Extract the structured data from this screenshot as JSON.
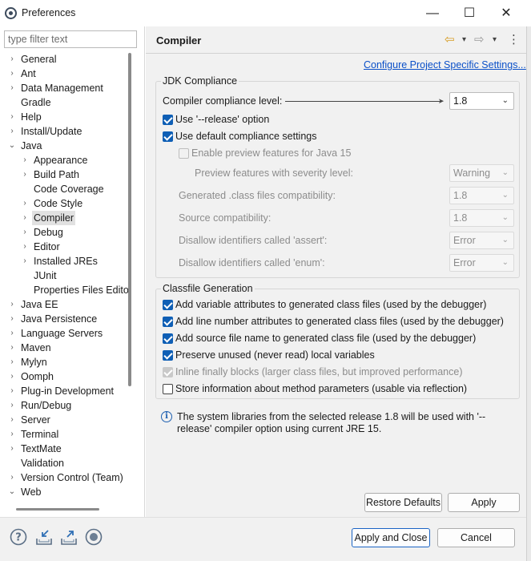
{
  "window": {
    "title": "Preferences",
    "controls": {
      "minimize": "—",
      "maximize": "☐",
      "close": "✕"
    }
  },
  "filter": {
    "placeholder": "type filter text",
    "value": ""
  },
  "tree": [
    {
      "label": "General",
      "arrow": "›",
      "depth": 0
    },
    {
      "label": "Ant",
      "arrow": "›",
      "depth": 0
    },
    {
      "label": "Data Management",
      "arrow": "›",
      "depth": 0
    },
    {
      "label": "Gradle",
      "arrow": "",
      "depth": 0
    },
    {
      "label": "Help",
      "arrow": "›",
      "depth": 0
    },
    {
      "label": "Install/Update",
      "arrow": "›",
      "depth": 0
    },
    {
      "label": "Java",
      "arrow": "⌄",
      "depth": 0
    },
    {
      "label": "Appearance",
      "arrow": "›",
      "depth": 1
    },
    {
      "label": "Build Path",
      "arrow": "›",
      "depth": 1
    },
    {
      "label": "Code Coverage",
      "arrow": "",
      "depth": 1
    },
    {
      "label": "Code Style",
      "arrow": "›",
      "depth": 1
    },
    {
      "label": "Compiler",
      "arrow": "›",
      "depth": 1,
      "selected": true
    },
    {
      "label": "Debug",
      "arrow": "›",
      "depth": 1
    },
    {
      "label": "Editor",
      "arrow": "›",
      "depth": 1
    },
    {
      "label": "Installed JREs",
      "arrow": "›",
      "depth": 1
    },
    {
      "label": "JUnit",
      "arrow": "",
      "depth": 1
    },
    {
      "label": "Properties Files Edito",
      "arrow": "",
      "depth": 1
    },
    {
      "label": "Java EE",
      "arrow": "›",
      "depth": 0
    },
    {
      "label": "Java Persistence",
      "arrow": "›",
      "depth": 0
    },
    {
      "label": "Language Servers",
      "arrow": "›",
      "depth": 0
    },
    {
      "label": "Maven",
      "arrow": "›",
      "depth": 0
    },
    {
      "label": "Mylyn",
      "arrow": "›",
      "depth": 0
    },
    {
      "label": "Oomph",
      "arrow": "›",
      "depth": 0
    },
    {
      "label": "Plug-in Development",
      "arrow": "›",
      "depth": 0
    },
    {
      "label": "Run/Debug",
      "arrow": "›",
      "depth": 0
    },
    {
      "label": "Server",
      "arrow": "›",
      "depth": 0
    },
    {
      "label": "Terminal",
      "arrow": "›",
      "depth": 0
    },
    {
      "label": "TextMate",
      "arrow": "›",
      "depth": 0
    },
    {
      "label": "Validation",
      "arrow": "",
      "depth": 0
    },
    {
      "label": "Version Control (Team)",
      "arrow": "›",
      "depth": 0
    },
    {
      "label": "Web",
      "arrow": "⌄",
      "depth": 0
    }
  ],
  "page": {
    "title": "Compiler",
    "configure_link": "Configure Project Specific Settings...",
    "nav": {
      "back": "⇦",
      "back_menu": "▾",
      "forward": "⇨",
      "forward_menu": "▾",
      "more": "⋮"
    }
  },
  "jdk": {
    "group_title": "JDK Compliance",
    "compliance_label": "Compiler compliance level:",
    "compliance_value": "1.8",
    "release_option": {
      "label": "Use '--release' option",
      "checked": true
    },
    "default_settings": {
      "label": "Use default compliance settings",
      "checked": true
    },
    "preview": {
      "label": "Enable preview features for Java 15",
      "checked": false,
      "enabled": false
    },
    "severity_label": "Preview features with severity level:",
    "severity_value": "Warning",
    "generated_label": "Generated .class files compatibility:",
    "generated_value": "1.8",
    "source_label": "Source compatibility:",
    "source_value": "1.8",
    "assert_label": "Disallow identifiers called 'assert':",
    "assert_value": "Error",
    "enum_label": "Disallow identifiers called 'enum':",
    "enum_value": "Error"
  },
  "classfile": {
    "group_title": "Classfile Generation",
    "options": [
      {
        "label": "Add variable attributes to generated class files (used by the debugger)",
        "checked": true,
        "enabled": true
      },
      {
        "label": "Add line number attributes to generated class files (used by the debugger)",
        "checked": true,
        "enabled": true
      },
      {
        "label": "Add source file name to generated class file (used by the debugger)",
        "checked": true,
        "enabled": true
      },
      {
        "label": "Preserve unused (never read) local variables",
        "checked": true,
        "enabled": true
      },
      {
        "label": "Inline finally blocks (larger class files, but improved performance)",
        "checked": true,
        "enabled": false
      },
      {
        "label": "Store information about method parameters (usable via reflection)",
        "checked": false,
        "enabled": true
      }
    ]
  },
  "info": {
    "icon": "info-icon",
    "text": "The system libraries from the selected release 1.8 will be used with '--release' compiler option using current JRE 15."
  },
  "page_buttons": {
    "restore": "Restore Defaults",
    "apply": "Apply"
  },
  "bottom": {
    "icons": [
      "help-icon",
      "import-icon",
      "export-icon",
      "record-icon"
    ],
    "apply_close": "Apply and Close",
    "cancel": "Cancel"
  },
  "colors": {
    "accent": "#0f5fb5",
    "link": "#0b50c8",
    "panel_bg": "#f1f1f1"
  }
}
